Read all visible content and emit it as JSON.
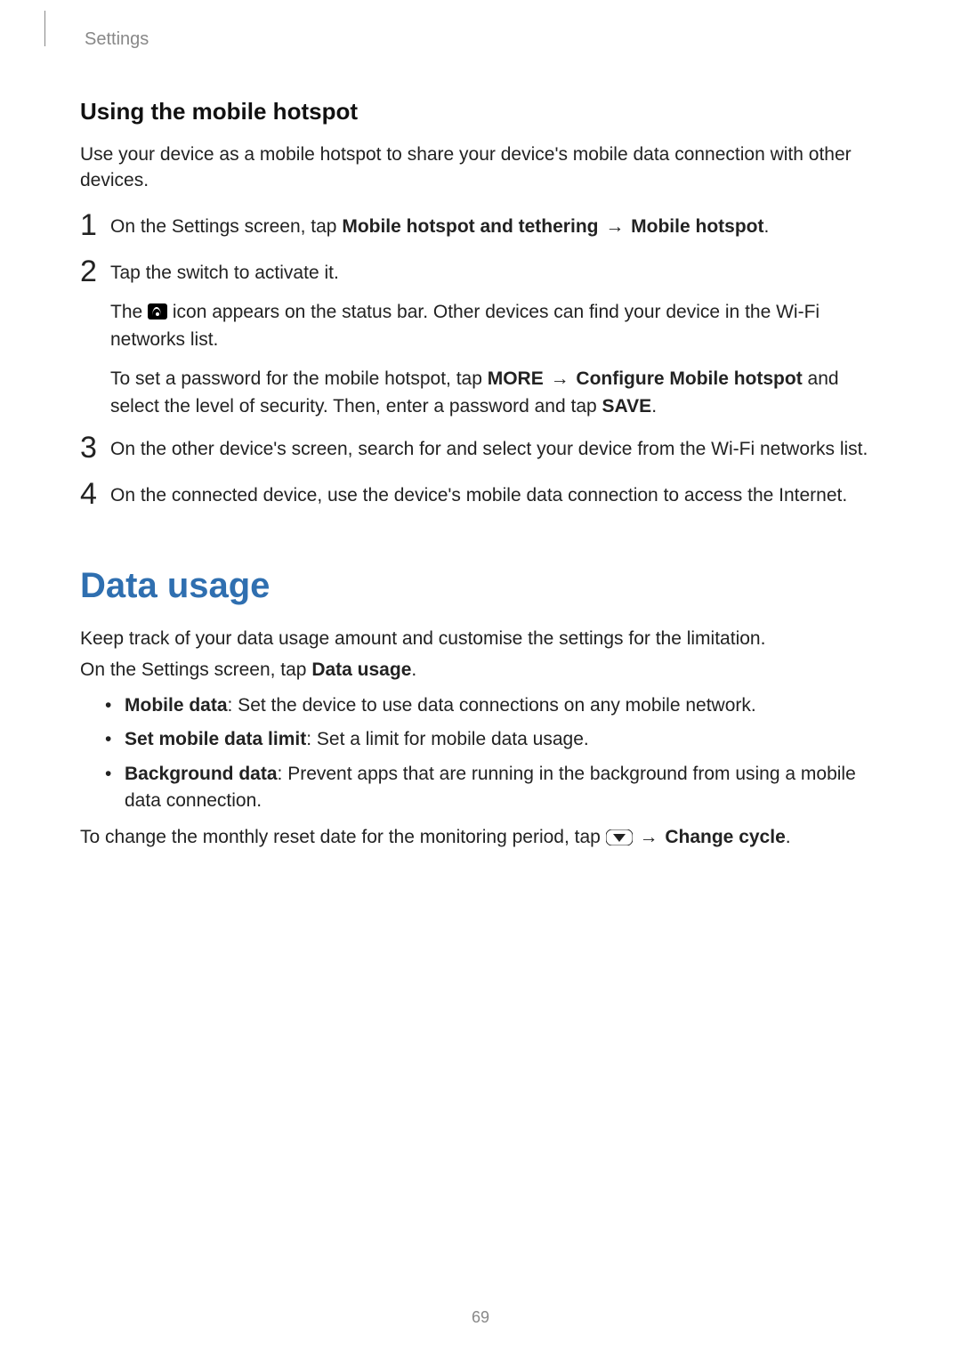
{
  "header": {
    "section": "Settings"
  },
  "hotspot": {
    "heading": "Using the mobile hotspot",
    "intro": "Use your device as a mobile hotspot to share your device's mobile data connection with other devices.",
    "steps": {
      "n1": "1",
      "s1_pre": "On the Settings screen, tap ",
      "s1_b1": "Mobile hotspot and tethering",
      "s1_arrow": " → ",
      "s1_b2": "Mobile hotspot",
      "s1_post": ".",
      "n2": "2",
      "s2_line1": "Tap the switch to activate it.",
      "s2_line2_pre": "The ",
      "s2_line2_post": " icon appears on the status bar. Other devices can find your device in the Wi-Fi networks list.",
      "s2_line3_pre": "To set a password for the mobile hotspot, tap ",
      "s2_line3_b1": "MORE",
      "s2_line3_arrow": " → ",
      "s2_line3_b2": "Configure Mobile hotspot",
      "s2_line3_mid": " and select the level of security. Then, enter a password and tap ",
      "s2_line3_b3": "SAVE",
      "s2_line3_post": ".",
      "n3": "3",
      "s3": "On the other device's screen, search for and select your device from the Wi-Fi networks list.",
      "n4": "4",
      "s4": "On the connected device, use the device's mobile data connection to access the Internet."
    }
  },
  "data_usage": {
    "heading": "Data usage",
    "intro1": "Keep track of your data usage amount and customise the settings for the limitation.",
    "intro2_pre": "On the Settings screen, tap ",
    "intro2_b": "Data usage",
    "intro2_post": ".",
    "bullets": {
      "b1_label": "Mobile data",
      "b1_text": ": Set the device to use data connections on any mobile network.",
      "b2_label": "Set mobile data limit",
      "b2_text": ": Set a limit for mobile data usage.",
      "b3_label": "Background data",
      "b3_text": ": Prevent apps that are running in the background from using a mobile data connection."
    },
    "footer_pre": "To change the monthly reset date for the monitoring period, tap ",
    "footer_arrow": " → ",
    "footer_b": "Change cycle",
    "footer_post": "."
  },
  "page_number": "69"
}
